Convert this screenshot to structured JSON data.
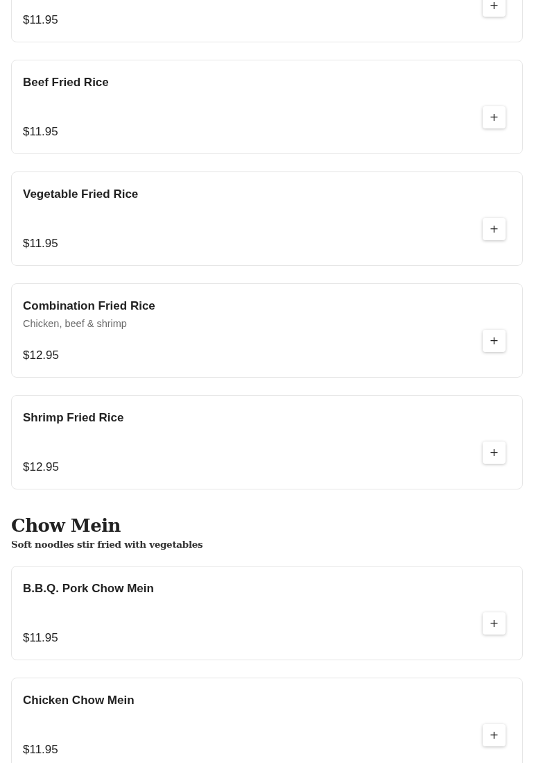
{
  "sections": [
    {
      "items": [
        {
          "price": "$11.95",
          "add_label": "+"
        },
        {
          "name": "Beef Fried Rice",
          "price": "$11.95",
          "add_label": "+"
        },
        {
          "name": "Vegetable Fried Rice",
          "price": "$11.95",
          "add_label": "+"
        },
        {
          "name": "Combination Fried Rice",
          "description": "Chicken, beef & shrimp",
          "price": "$12.95",
          "add_label": "+"
        },
        {
          "name": "Shrimp Fried Rice",
          "price": "$12.95",
          "add_label": "+"
        }
      ]
    },
    {
      "title": "Chow Mein",
      "subtitle": "Soft noodles stir fried with vegetables",
      "items": [
        {
          "name": "B.B.Q. Pork Chow Mein",
          "price": "$11.95",
          "add_label": "+"
        },
        {
          "name": "Chicken Chow Mein",
          "price": "$11.95",
          "add_label": "+"
        }
      ]
    }
  ]
}
